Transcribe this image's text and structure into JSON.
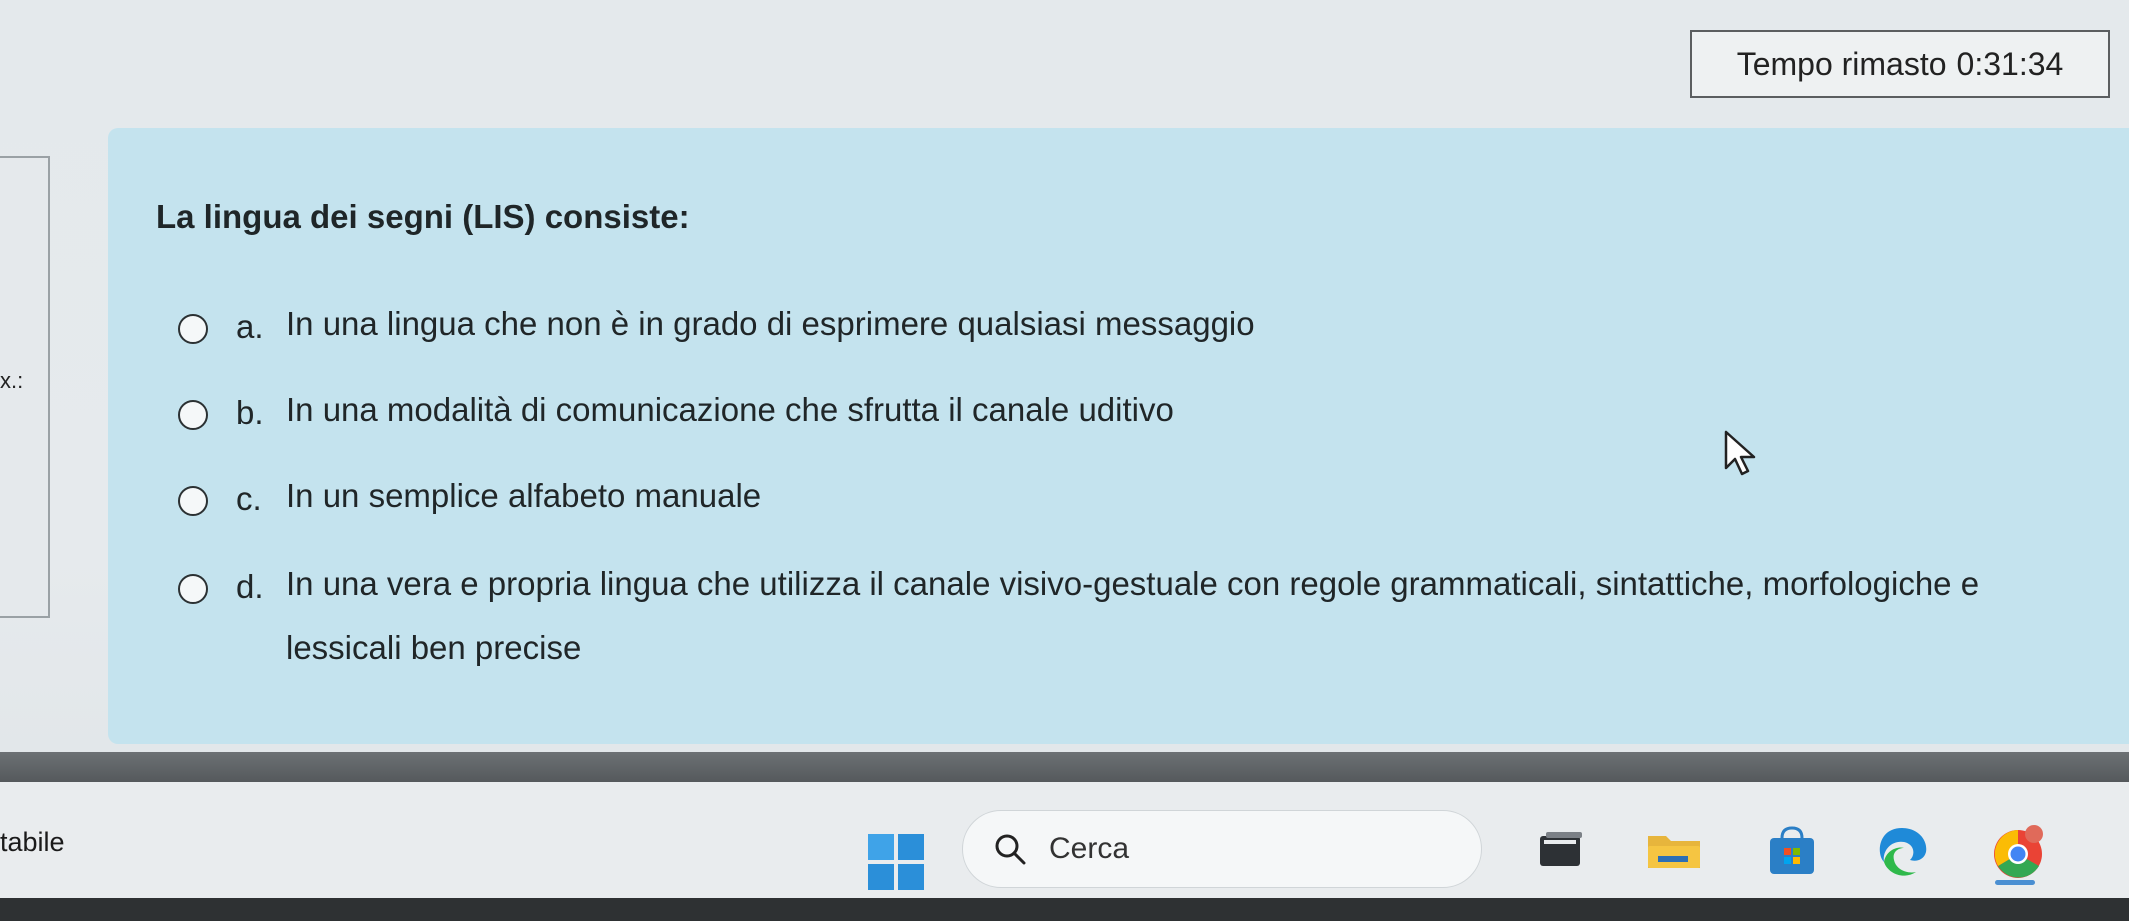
{
  "timer": {
    "label": "Tempo rimasto",
    "value": "0:31:34"
  },
  "left_nav": {
    "fragment": "x.:"
  },
  "question": {
    "text": "La lingua dei segni (LIS) consiste:",
    "answers": [
      {
        "letter": "a.",
        "text": "In una lingua che non è in grado di esprimere qualsiasi messaggio",
        "selected": false
      },
      {
        "letter": "b.",
        "text": "In una modalità di comunicazione che sfrutta il canale uditivo",
        "selected": false
      },
      {
        "letter": "c.",
        "text": "In un semplice alfabeto manuale",
        "selected": false
      },
      {
        "letter": "d.",
        "text": "In una vera e propria lingua che utilizza il canale visivo-gestuale con regole grammaticali, sintattiche, morfologiche e lessicali ben precise",
        "selected": false
      }
    ]
  },
  "taskbar": {
    "left_label": "tabile",
    "search_label": "Cerca"
  },
  "colors": {
    "panel": "#c4e3ee",
    "accent": "#2b8fd9"
  }
}
